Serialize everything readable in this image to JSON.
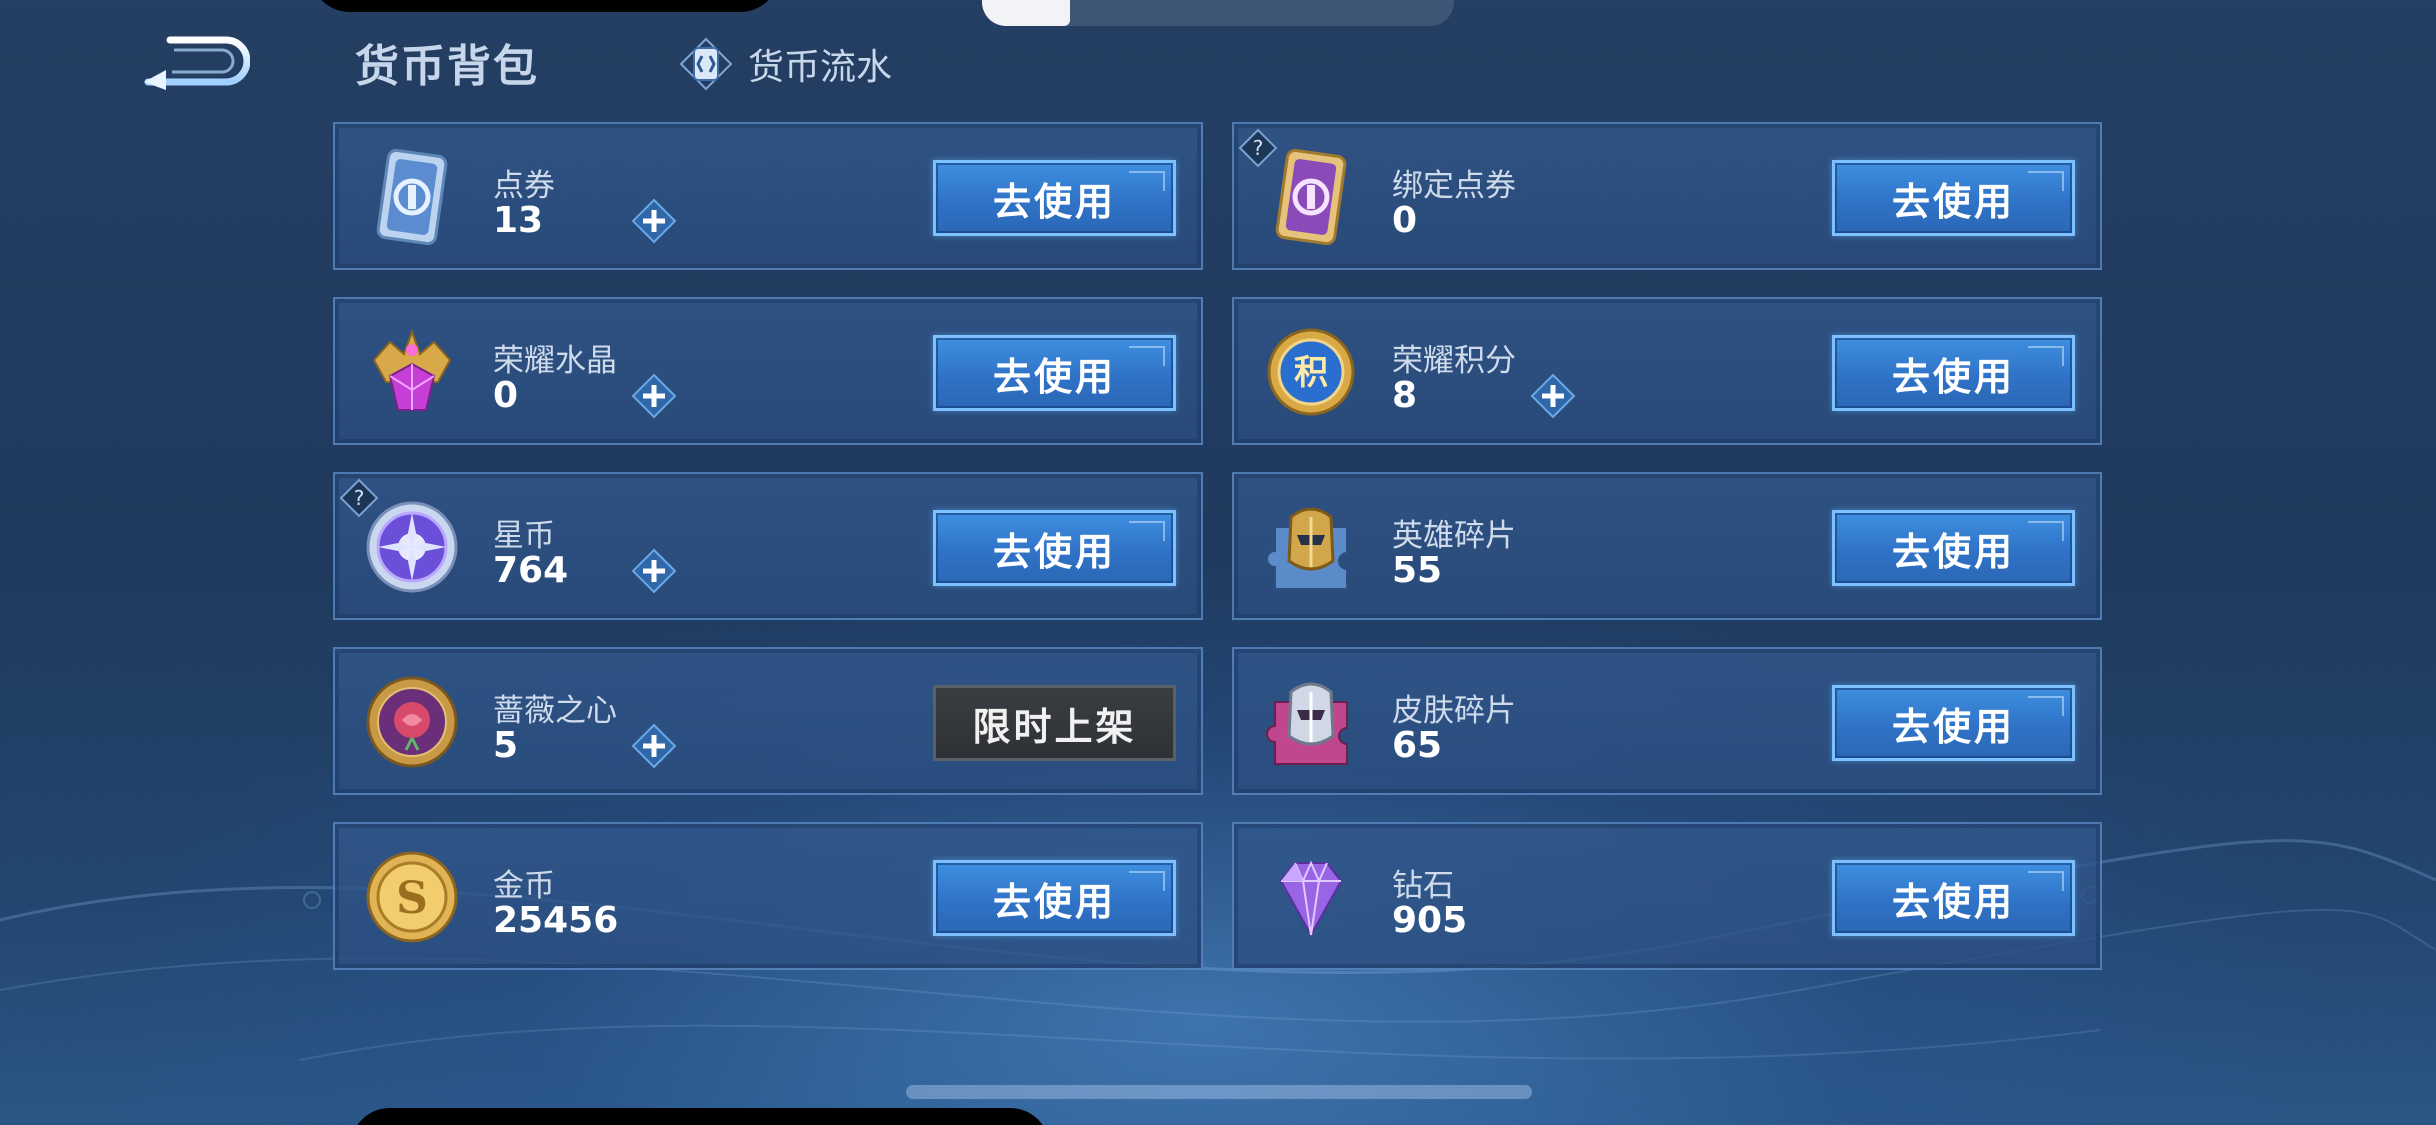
{
  "header": {
    "title": "货币背包",
    "flow_label": "货币流水"
  },
  "cards": [
    {
      "name": "点券",
      "amount": "13",
      "button": "去使用",
      "icon": "coupon-blue-icon"
    },
    {
      "name": "绑定点券",
      "amount": "0",
      "button": "去使用",
      "icon": "coupon-purple-icon"
    },
    {
      "name": "荣耀水晶",
      "amount": "0",
      "button": "去使用",
      "icon": "glory-crystal-icon"
    },
    {
      "name": "荣耀积分",
      "amount": "8",
      "button": "去使用",
      "icon": "glory-points-icon",
      "badge_text": "积"
    },
    {
      "name": "星币",
      "amount": "764",
      "button": "去使用",
      "icon": "star-coin-icon"
    },
    {
      "name": "英雄碎片",
      "amount": "55",
      "button": "去使用",
      "icon": "hero-fragment-icon"
    },
    {
      "name": "蔷薇之心",
      "amount": "5",
      "button": "限时上架",
      "icon": "rose-heart-icon"
    },
    {
      "name": "皮肤碎片",
      "amount": "65",
      "button": "去使用",
      "icon": "skin-fragment-icon"
    },
    {
      "name": "金币",
      "amount": "25456",
      "button": "去使用",
      "icon": "gold-coin-icon",
      "badge_text": "S"
    },
    {
      "name": "钻石",
      "amount": "905",
      "button": "去使用",
      "icon": "diamond-icon"
    }
  ],
  "colors": {
    "background": "#213c61",
    "button_blue": "#3478cc",
    "button_disabled": "#34373c",
    "card_border": "#6ea0dc"
  }
}
